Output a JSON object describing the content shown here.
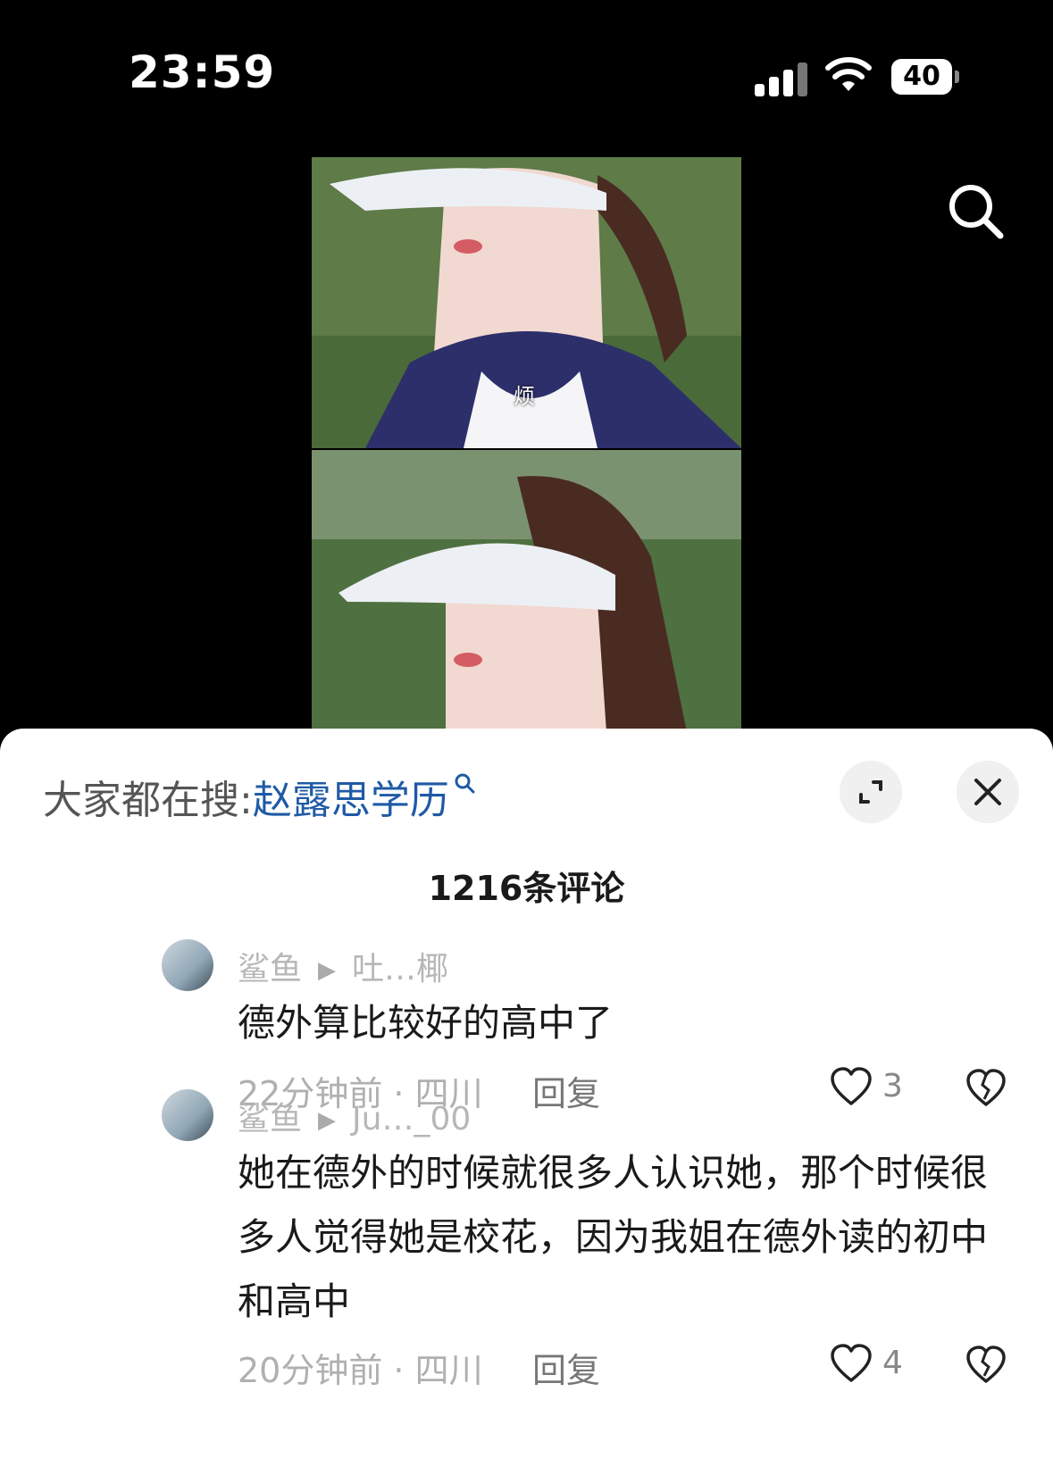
{
  "status_bar": {
    "time": "23:59",
    "battery": "40"
  },
  "video": {
    "subtitle": "烦"
  },
  "sheet": {
    "search_hint": {
      "label": "大家都在搜:",
      "term": "赵露思学历"
    },
    "comment_count": "1216条评论",
    "comments": [
      {
        "author": "鲨鱼",
        "reply_to": "吐…椰",
        "text": "德外算比较好的高中了",
        "time_location": "22分钟前 · 四川",
        "reply_label": "回复",
        "likes": "3"
      },
      {
        "author": "鲨鱼",
        "reply_to": "Ju…_00",
        "text": "她在德外的时候就很多人认识她，那个时候很多人觉得她是校花，因为我姐在德外读的初中和高中",
        "time_location": "20分钟前 · 四川",
        "reply_label": "回复",
        "likes": "4"
      }
    ]
  }
}
